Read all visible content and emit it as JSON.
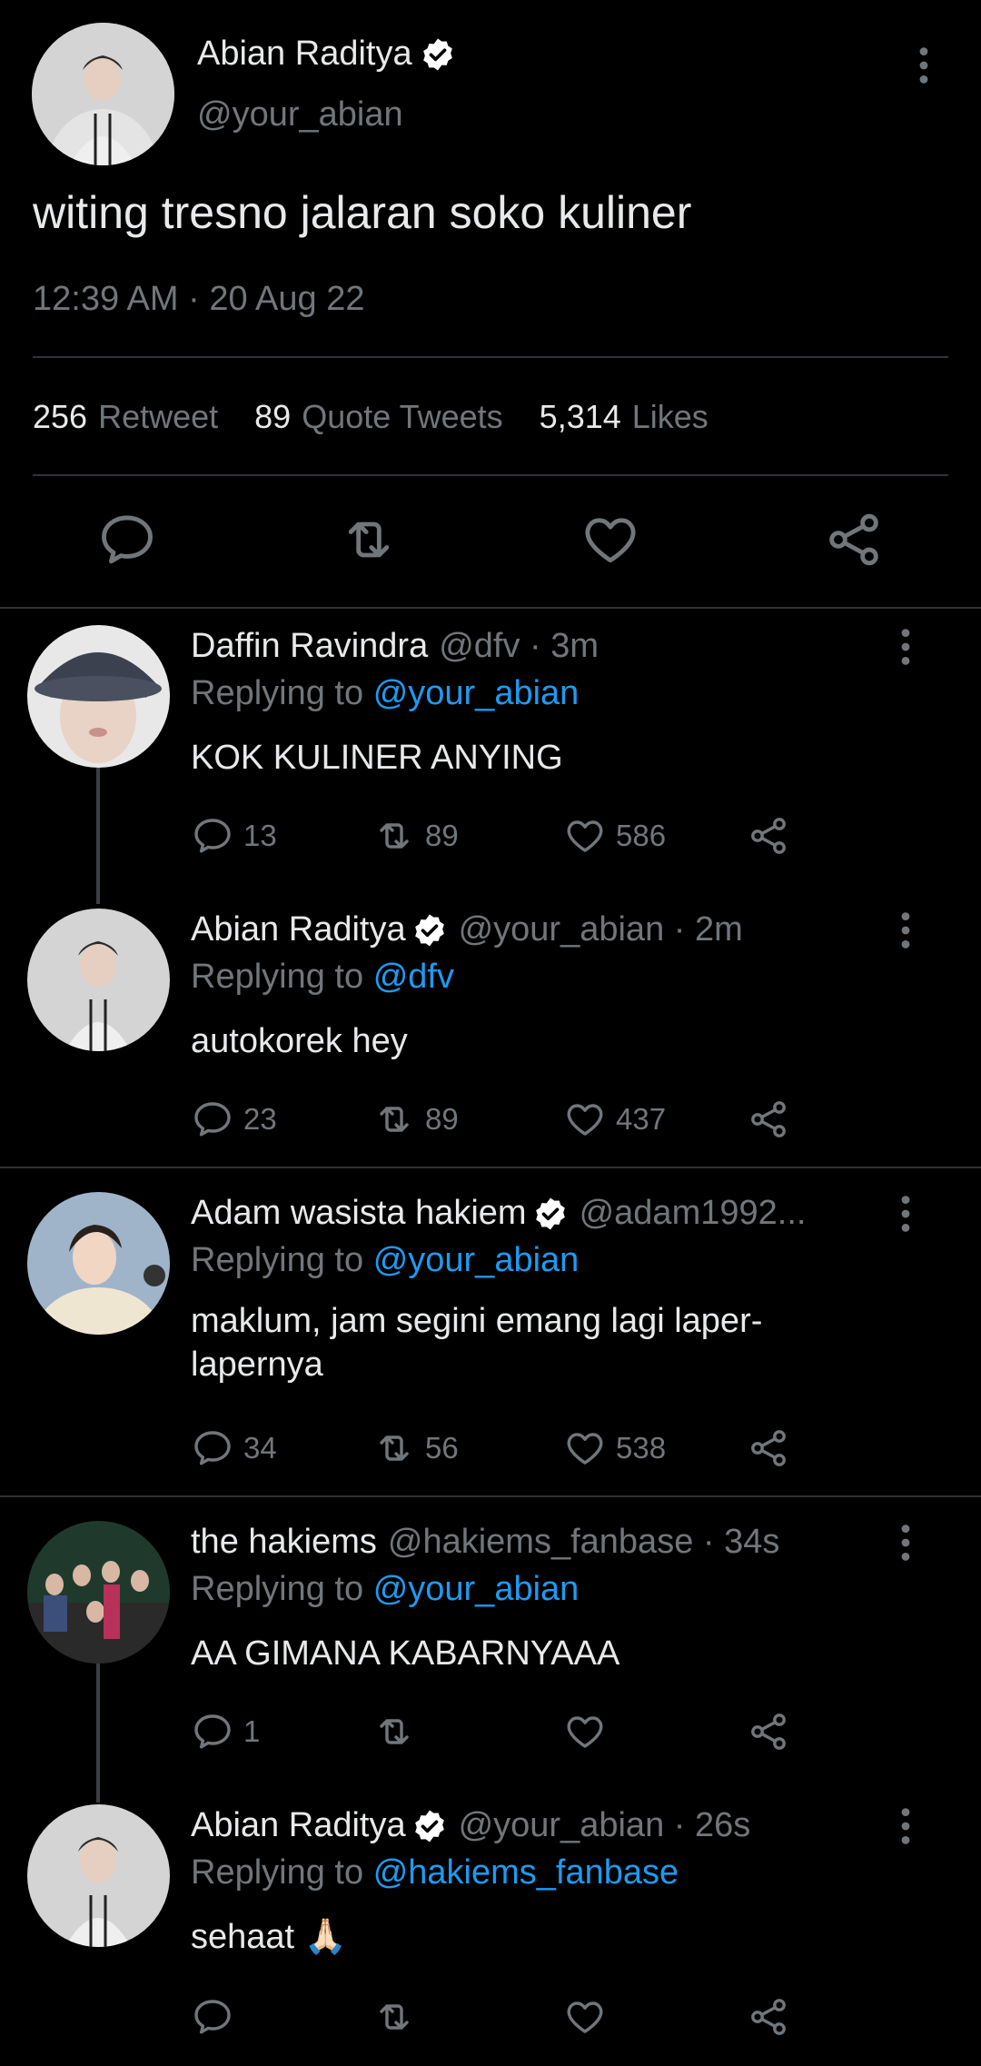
{
  "main_tweet": {
    "name": "Abian Raditya",
    "handle": "@your_abian",
    "text": "witing tresno jalaran soko kuliner",
    "timestamp": "12:39 AM · 20 Aug 22",
    "stats": {
      "retweets": "256",
      "retweets_label": "Retweet",
      "quotes": "89",
      "quotes_label": "Quote Tweets",
      "likes": "5,314",
      "likes_label": "Likes"
    }
  },
  "replies": [
    {
      "name": "Daffin Ravindra",
      "handle": "@dfv · 3m",
      "replying_prefix": "Replying to",
      "replying_to": "@your_abian",
      "text": "KOK KULINER ANYING",
      "comments": "13",
      "retweets": "89",
      "likes": "586"
    },
    {
      "name": "Abian Raditya",
      "handle": "@your_abian · 2m",
      "replying_prefix": "Replying to",
      "replying_to": "@dfv",
      "text": "autokorek hey",
      "comments": "23",
      "retweets": "89",
      "likes": "437"
    },
    {
      "name": "Adam wasista hakiem",
      "handle": "@adam1992...",
      "replying_prefix": "Replying to",
      "replying_to": "@your_abian",
      "text": "maklum, jam segini emang lagi laper-lapernya",
      "comments": "34",
      "retweets": "56",
      "likes": "538"
    },
    {
      "name": "the hakiems",
      "handle": "@hakiems_fanbase · 34s",
      "replying_prefix": "Replying to",
      "replying_to": "@your_abian",
      "text": "AA GIMANA KABARNYAAA",
      "comments": "1",
      "retweets": "",
      "likes": ""
    },
    {
      "name": "Abian Raditya",
      "handle": "@your_abian · 26s",
      "replying_prefix": "Replying to",
      "replying_to": "@hakiems_fanbase",
      "text": "sehaat 🙏🏻",
      "comments": "",
      "retweets": "",
      "likes": ""
    }
  ],
  "colors": {
    "background": "#000000",
    "text": "#e7e9ea",
    "muted": "#71767b",
    "link": "#1d9bf0",
    "verified": "#ffffff"
  }
}
